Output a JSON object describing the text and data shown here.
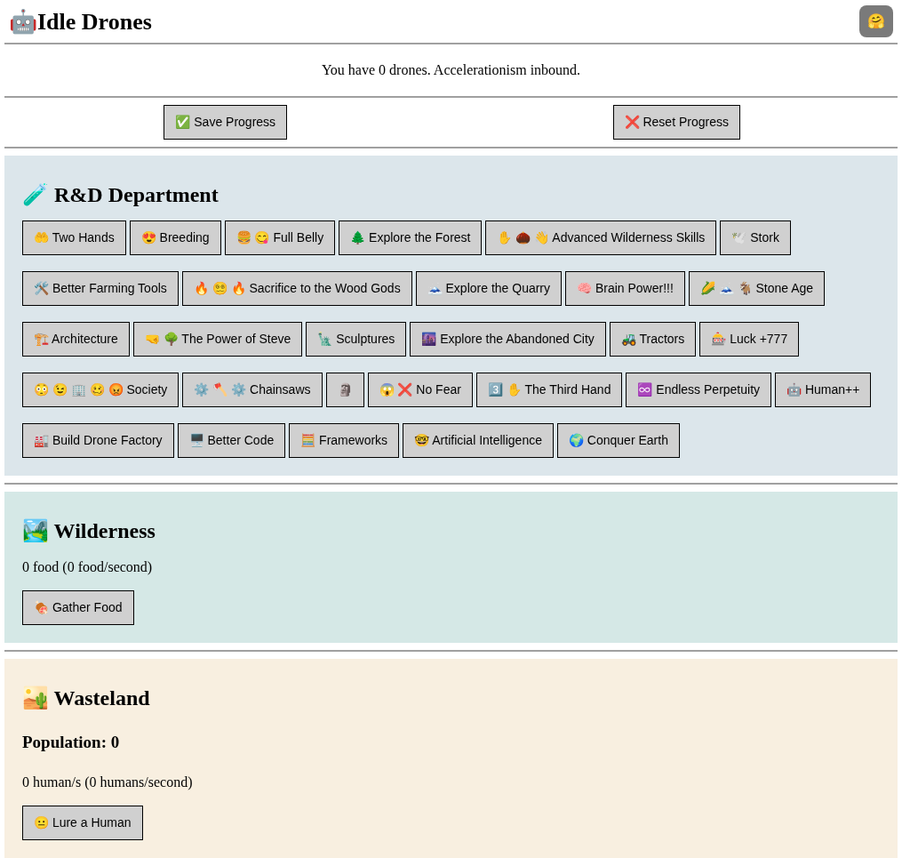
{
  "header": {
    "icon": "🤖",
    "title": "Idle Drones",
    "theme_button": "🤗"
  },
  "status": "You have 0 drones. Accelerationism inbound.",
  "actions": [
    "✅ Save Progress",
    "❌ Reset Progress"
  ],
  "sections": [
    {
      "kind": "research",
      "icon": "🧪",
      "title": "R&D Department",
      "buttons": [
        "🤲 Two Hands",
        "😍 Breeding",
        "🍔 😋 Full Belly",
        "🌲 Explore the Forest",
        "✋ 🌰 👋 Advanced Wilderness Skills",
        "🕊️ Stork",
        "🛠️ Better Farming Tools",
        "🔥 😵‍💫 🔥 Sacrifice to the Wood Gods",
        "🗻 Explore the Quarry",
        "🧠 Brain Power!!!",
        "🌽 🗻 🐐 Stone Age",
        "🏗️ Architecture",
        "🤜 🌳 The Power of Steve",
        "🗽 Sculptures",
        "🌆 Explore the Abandoned City",
        "🚜 Tractors",
        "🎰 Luck +777",
        "😳 😉 🏢 🥴 😡 Society",
        "⚙️ 🪓 ⚙️ Chainsaws",
        "🗿",
        "😱 ❌ No Fear",
        "3️⃣ ✋ The Third Hand",
        "♾️ Endless Perpetuity",
        "🤖 Human++",
        "🏭 Build Drone Factory",
        "🖥️ Better Code",
        "🧮 Frameworks",
        "🤓 Artificial Intelligence",
        "🌍 Conquer Earth"
      ]
    },
    {
      "kind": "wilderness",
      "icon": "🏞️",
      "title": "Wilderness",
      "lines": [
        "0 food (0 food/second)"
      ],
      "buttons": [
        "🍖 Gather Food"
      ]
    },
    {
      "kind": "wasteland",
      "icon": "🏜️",
      "title": "Wasteland",
      "subtitle": "Population: 0",
      "lines": [
        "0 human/s (0 humans/second)"
      ],
      "buttons": [
        "😐 Lure a Human"
      ]
    }
  ]
}
